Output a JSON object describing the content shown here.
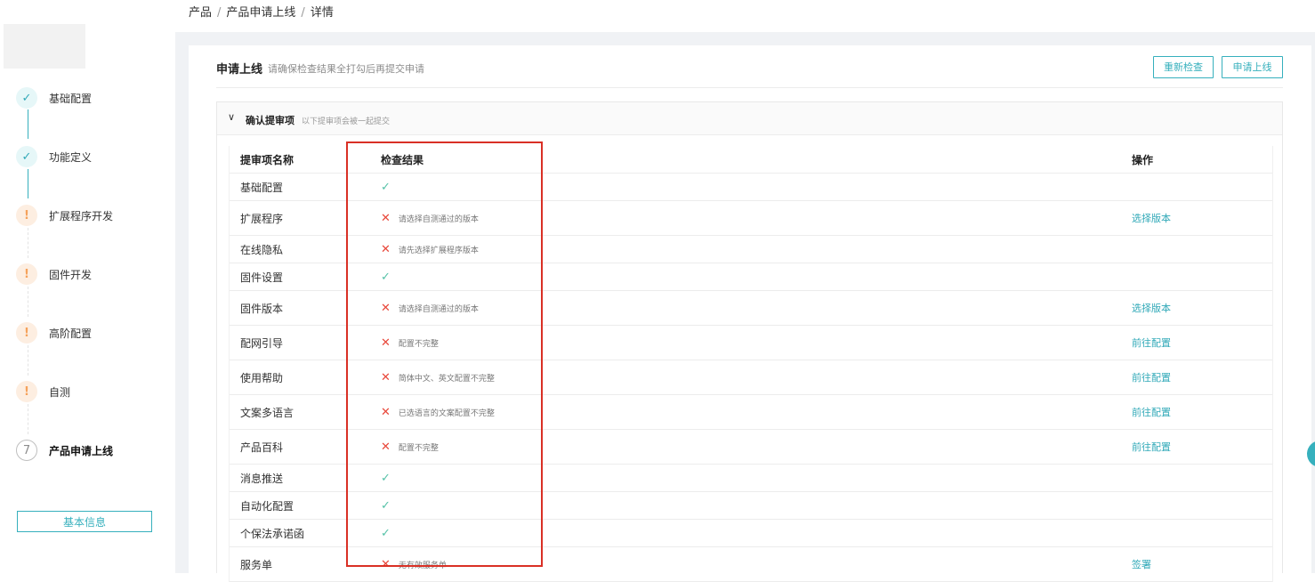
{
  "breadcrumb": {
    "item1": "产品",
    "item2": "产品申请上线",
    "item3": "详情",
    "separator": "/"
  },
  "sidebar": {
    "steps": [
      {
        "label": "基础配置",
        "status": "done",
        "icon": "✓"
      },
      {
        "label": "功能定义",
        "status": "done",
        "icon": "✓"
      },
      {
        "label": "扩展程序开发",
        "status": "warn",
        "icon": "!"
      },
      {
        "label": "固件开发",
        "status": "warn",
        "icon": "!"
      },
      {
        "label": "高阶配置",
        "status": "warn",
        "icon": "!"
      },
      {
        "label": "自测",
        "status": "warn",
        "icon": "!"
      },
      {
        "label": "产品申请上线",
        "status": "active",
        "icon": "7"
      }
    ],
    "basic_info_label": "基本信息"
  },
  "header": {
    "title": "申请上线",
    "hint": "请确保检查结果全打勾后再提交申请",
    "recheck_label": "重新检查",
    "apply_label": "申请上线"
  },
  "card": {
    "title": "确认提审项",
    "subtitle": "以下提审项会被一起提交",
    "chevron": "∨"
  },
  "table": {
    "headers": {
      "name": "提审项名称",
      "result": "检查结果",
      "op": "操作"
    },
    "rows": [
      {
        "name": "基础配置",
        "ok": true,
        "msg": "",
        "op": ""
      },
      {
        "name": "扩展程序",
        "ok": false,
        "msg": "请选择自测通过的版本",
        "op": "选择版本"
      },
      {
        "name": "在线隐私",
        "ok": false,
        "msg": "请先选择扩展程序版本",
        "op": ""
      },
      {
        "name": "固件设置",
        "ok": true,
        "msg": "",
        "op": ""
      },
      {
        "name": "固件版本",
        "ok": false,
        "msg": "请选择自测通过的版本",
        "op": "选择版本"
      },
      {
        "name": "配网引导",
        "ok": false,
        "msg": "配置不完整",
        "op": "前往配置"
      },
      {
        "name": "使用帮助",
        "ok": false,
        "msg": "简体中文、英文配置不完整",
        "op": "前往配置"
      },
      {
        "name": "文案多语言",
        "ok": false,
        "msg": "已选语言的文案配置不完整",
        "op": "前往配置"
      },
      {
        "name": "产品百科",
        "ok": false,
        "msg": "配置不完整",
        "op": "前往配置"
      },
      {
        "name": "消息推送",
        "ok": true,
        "msg": "",
        "op": ""
      },
      {
        "name": "自动化配置",
        "ok": true,
        "msg": "",
        "op": ""
      },
      {
        "name": "个保法承诺函",
        "ok": true,
        "msg": "",
        "op": ""
      },
      {
        "name": "服务单",
        "ok": false,
        "msg": "无有效服务单",
        "op": "签署"
      }
    ],
    "ok_icon": "✓",
    "fail_icon": "✕"
  },
  "colors": {
    "accent": "#36b0bd",
    "error": "#e8473a",
    "success": "#56c2a8",
    "warning": "#f5a25b",
    "highlight": "#d93025"
  }
}
